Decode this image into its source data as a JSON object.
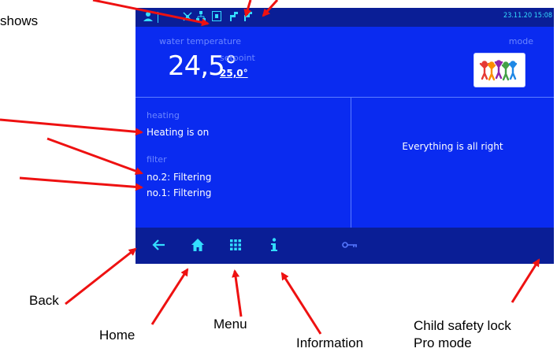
{
  "annotations": {
    "shows": "shows",
    "back": "Back",
    "home": "Home",
    "menu": "Menu",
    "information": "Information",
    "child_lock": "Child safety lock",
    "pro_mode": "Pro mode"
  },
  "status_bar": {
    "datetime": "23.11.20 15:08",
    "icons": [
      "user-icon",
      "pump-icon",
      "network-icon",
      "display-icon",
      "valve-icon",
      "valve-icon"
    ]
  },
  "main": {
    "water_temperature_label": "water temperature",
    "water_temperature_value": "24,5°",
    "setpoint_label": "setpoint",
    "setpoint_value": "25,0°",
    "mode_label": "mode"
  },
  "heating": {
    "label": "heating",
    "status": "Heating is on"
  },
  "filter": {
    "label": "filter",
    "lines": [
      "no.2: Filtering",
      "no.1: Filtering"
    ]
  },
  "system_message": "Everything is all right",
  "nav": {
    "items": [
      "back-arrow-icon",
      "home-icon",
      "menu-grid-icon",
      "info-icon",
      "key-icon"
    ]
  },
  "colors": {
    "screen_bg": "#0a2bf0",
    "bar_bg": "#0a1e96",
    "accent": "#33ddff",
    "dim_label": "#6c86ff",
    "arrow": "#ee1111"
  }
}
